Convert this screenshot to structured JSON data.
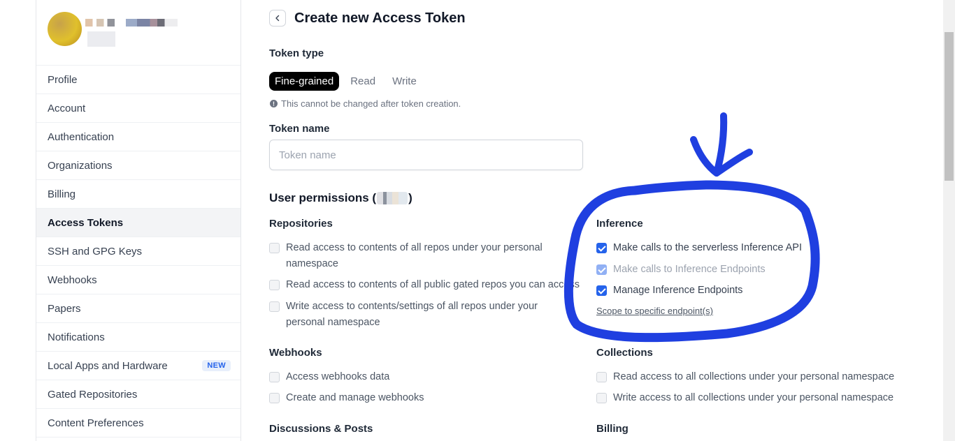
{
  "sidebar": {
    "items": [
      {
        "label": "Profile"
      },
      {
        "label": "Account"
      },
      {
        "label": "Authentication"
      },
      {
        "label": "Organizations"
      },
      {
        "label": "Billing"
      },
      {
        "label": "Access Tokens",
        "active": true
      },
      {
        "label": "SSH and GPG Keys"
      },
      {
        "label": "Webhooks"
      },
      {
        "label": "Papers"
      },
      {
        "label": "Notifications"
      },
      {
        "label": "Local Apps and Hardware",
        "badge": "NEW"
      },
      {
        "label": "Gated Repositories"
      },
      {
        "label": "Content Preferences"
      }
    ]
  },
  "header": {
    "back_icon": "chevron-left-icon",
    "title": "Create new Access Token"
  },
  "token_type": {
    "label": "Token type",
    "tabs": [
      "Fine-grained",
      "Read",
      "Write"
    ],
    "selected": "Fine-grained",
    "hint": "This cannot be changed after token creation."
  },
  "token_name": {
    "label": "Token name",
    "placeholder": "Token name",
    "value": ""
  },
  "permissions": {
    "title_prefix": "User permissions (",
    "title_suffix": ")",
    "repositories": {
      "title": "Repositories",
      "items": [
        {
          "label": "Read access to contents of all repos under your personal namespace",
          "checked": false
        },
        {
          "label": "Read access to contents of all public gated repos you can access",
          "checked": false
        },
        {
          "label": "Write access to contents/settings of all repos under your personal namespace",
          "checked": false
        }
      ]
    },
    "inference": {
      "title": "Inference",
      "items": [
        {
          "label": "Make calls to the serverless Inference API",
          "checked": true
        },
        {
          "label": "Make calls to Inference Endpoints",
          "checked": true,
          "disabled": true
        },
        {
          "label": "Manage Inference Endpoints",
          "checked": true
        }
      ],
      "scope_link": "Scope to specific endpoint(s)"
    },
    "webhooks": {
      "title": "Webhooks",
      "items": [
        {
          "label": "Access webhooks data",
          "checked": false
        },
        {
          "label": "Create and manage webhooks",
          "checked": false
        }
      ]
    },
    "collections": {
      "title": "Collections",
      "items": [
        {
          "label": "Read access to all collections under your personal namespace",
          "checked": false
        },
        {
          "label": "Write access to all collections under your personal namespace",
          "checked": false
        }
      ]
    },
    "discussions": {
      "title": "Discussions & Posts"
    },
    "billing": {
      "title": "Billing"
    }
  },
  "colors": {
    "accent": "#2563eb",
    "annotation": "#1f3fe0",
    "active_tab_bg": "#000000"
  }
}
